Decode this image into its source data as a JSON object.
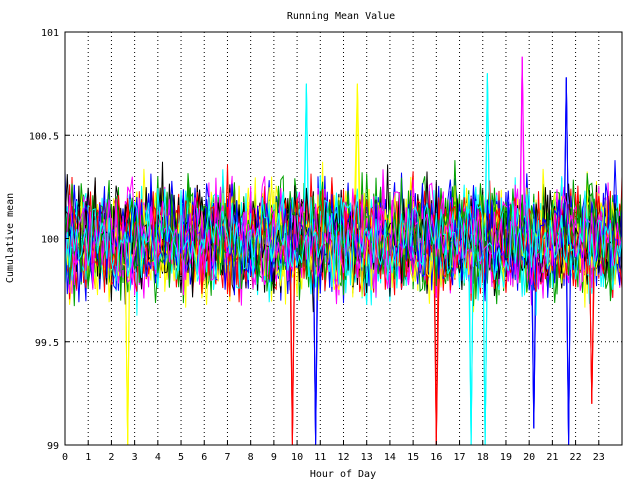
{
  "chart_data": {
    "type": "line",
    "title": "Running Mean Value",
    "xlabel": "Hour of Day",
    "ylabel": "Cumulative mean",
    "xlim": [
      0,
      24
    ],
    "ylim": [
      99,
      101
    ],
    "x_ticks": [
      "0",
      "1",
      "2",
      "3",
      "4",
      "5",
      "6",
      "7",
      "8",
      "9",
      "10",
      "11",
      "12",
      "13",
      "14",
      "15",
      "16",
      "17",
      "18",
      "19",
      "20",
      "21",
      "22",
      "23"
    ],
    "y_ticks": [
      "99",
      "99.5",
      "100",
      "100.5",
      "101"
    ],
    "grid": "dotted",
    "legend": "none",
    "series_colors": [
      "#ff0000",
      "#0000ff",
      "#00a000",
      "#ff00ff",
      "#00ffff",
      "#ffff00",
      "#000000"
    ],
    "line_count": 40,
    "samples_per_hour": 10,
    "center": 100,
    "typical_range": [
      99.5,
      100.6
    ],
    "notable_spikes": [
      {
        "x": 2.7,
        "y": 99.0,
        "color": "#ffff00"
      },
      {
        "x": 9.8,
        "y": 99.0,
        "color": "#ff0000"
      },
      {
        "x": 10.4,
        "y": 100.75,
        "color": "#00ffff"
      },
      {
        "x": 10.8,
        "y": 99.0,
        "color": "#0000ff"
      },
      {
        "x": 12.6,
        "y": 100.75,
        "color": "#ffff00"
      },
      {
        "x": 16.0,
        "y": 99.0,
        "color": "#ff0000"
      },
      {
        "x": 17.5,
        "y": 99.0,
        "color": "#00ffff"
      },
      {
        "x": 18.1,
        "y": 99.0,
        "color": "#00ffff"
      },
      {
        "x": 18.2,
        "y": 100.8,
        "color": "#00ffff"
      },
      {
        "x": 19.7,
        "y": 100.88,
        "color": "#ff00ff"
      },
      {
        "x": 20.2,
        "y": 99.08,
        "color": "#0000ff"
      },
      {
        "x": 21.6,
        "y": 100.78,
        "color": "#0000ff"
      },
      {
        "x": 21.7,
        "y": 99.0,
        "color": "#0000ff"
      },
      {
        "x": 22.7,
        "y": 99.2,
        "color": "#ff0000"
      }
    ]
  }
}
